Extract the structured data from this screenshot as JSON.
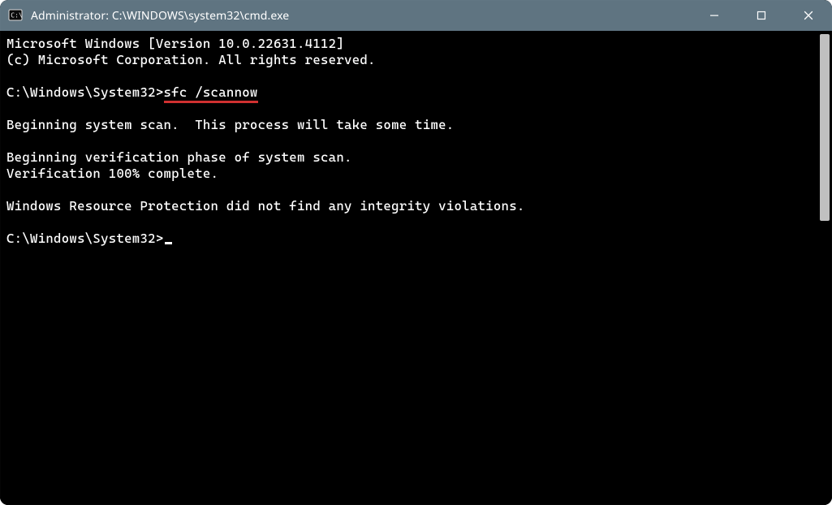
{
  "titlebar": {
    "title": "Administrator: C:\\WINDOWS\\system32\\cmd.exe"
  },
  "console": {
    "line1": "Microsoft Windows [Version 10.0.22631.4112]",
    "line2": "(c) Microsoft Corporation. All rights reserved.",
    "blank1": "",
    "prompt1_prefix": "C:\\Windows\\System32>",
    "prompt1_cmd": "sfc /scannow",
    "blank2": "",
    "line3": "Beginning system scan.  This process will take some time.",
    "blank3": "",
    "line4": "Beginning verification phase of system scan.",
    "line5": "Verification 100% complete.",
    "blank4": "",
    "line6": "Windows Resource Protection did not find any integrity violations.",
    "blank5": "",
    "prompt2": "C:\\Windows\\System32>"
  }
}
